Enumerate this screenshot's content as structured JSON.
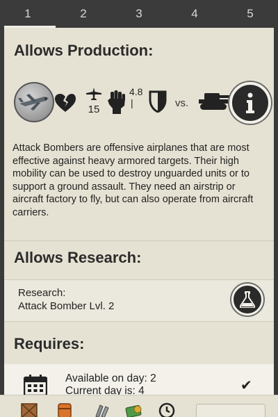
{
  "tabs": [
    {
      "label": "1",
      "active": true
    },
    {
      "label": "2",
      "active": false
    },
    {
      "label": "3",
      "active": false
    },
    {
      "label": "4",
      "active": false
    },
    {
      "label": "5",
      "active": false
    }
  ],
  "production": {
    "title": "Allows Production:",
    "unit_icon": "attack-bomber-icon",
    "stats": {
      "speed_value": "15",
      "attack_value": "4.8",
      "attack_sub": "|"
    },
    "vs_label": "vs.",
    "target_icon": "tank-icon",
    "description": "Attack Bombers are offensive airplanes that are most effective against heavy armored targets. Their high mobility can be used to destroy unguarded units or to support a ground assault. They need an airstrip or aircraft factory to fly, but can also operate from aircraft carriers."
  },
  "research": {
    "title": "Allows Research:",
    "label": "Research:",
    "item": "Attack Bomber Lvl. 2"
  },
  "requires": {
    "title": "Requires:",
    "line1": "Available on day: 2",
    "line2": "Current day is: 4"
  },
  "colors": {
    "tabbar": "#3b3b3b",
    "panel": "#e6e2d3",
    "accent_dark": "#2a2a2a"
  }
}
